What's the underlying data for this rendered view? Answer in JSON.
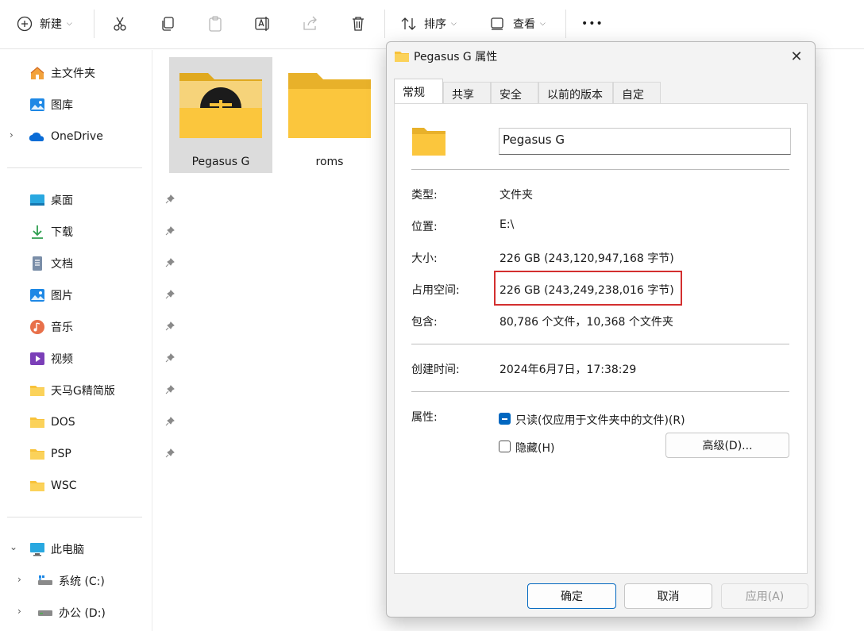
{
  "toolbar": {
    "new_label": "新建",
    "sort_label": "排序",
    "view_label": "查看",
    "more_label": "•••"
  },
  "sidebar": {
    "home": "主文件夹",
    "gallery": "图库",
    "onedrive": "OneDrive",
    "desktop": "桌面",
    "downloads": "下载",
    "documents": "文档",
    "pictures": "图片",
    "music": "音乐",
    "videos": "视频",
    "folder_tianma": "天马G精简版",
    "folder_dos": "DOS",
    "folder_psp": "PSP",
    "folder_wsc": "WSC",
    "this_pc": "此电脑",
    "drive_c": "系统 (C:)",
    "drive_d": "办公 (D:)"
  },
  "files": [
    {
      "name": "Pegasus G"
    },
    {
      "name": "roms"
    }
  ],
  "dialog": {
    "title": "Pegasus G 属性",
    "close_glyph": "✕",
    "tabs": [
      "常规",
      "共享",
      "安全",
      "以前的版本",
      "自定义"
    ],
    "folder_name": "Pegasus G",
    "type_label": "类型:",
    "type_value": "文件夹",
    "location_label": "位置:",
    "location_value": "E:\\",
    "size_label": "大小:",
    "size_value": "226 GB (243,120,947,168 字节)",
    "size_on_disk_label": "占用空间:",
    "size_on_disk_value": "226 GB (243,249,238,016 字节)",
    "contains_label": "包含:",
    "contains_value": "80,786 个文件，10,368 个文件夹",
    "created_label": "创建时间:",
    "created_value": "2024年6月7日，17:38:29",
    "attributes_label": "属性:",
    "readonly_label": "只读(仅应用于文件夹中的文件)(R)",
    "hidden_label": "隐藏(H)",
    "advanced_button": "高级(D)...",
    "ok_button": "确定",
    "cancel_button": "取消",
    "apply_button": "应用(A)"
  },
  "colors": {
    "accent": "#0067c0",
    "folder": "#f8c23a",
    "highlight_box": "#d32f2f"
  }
}
